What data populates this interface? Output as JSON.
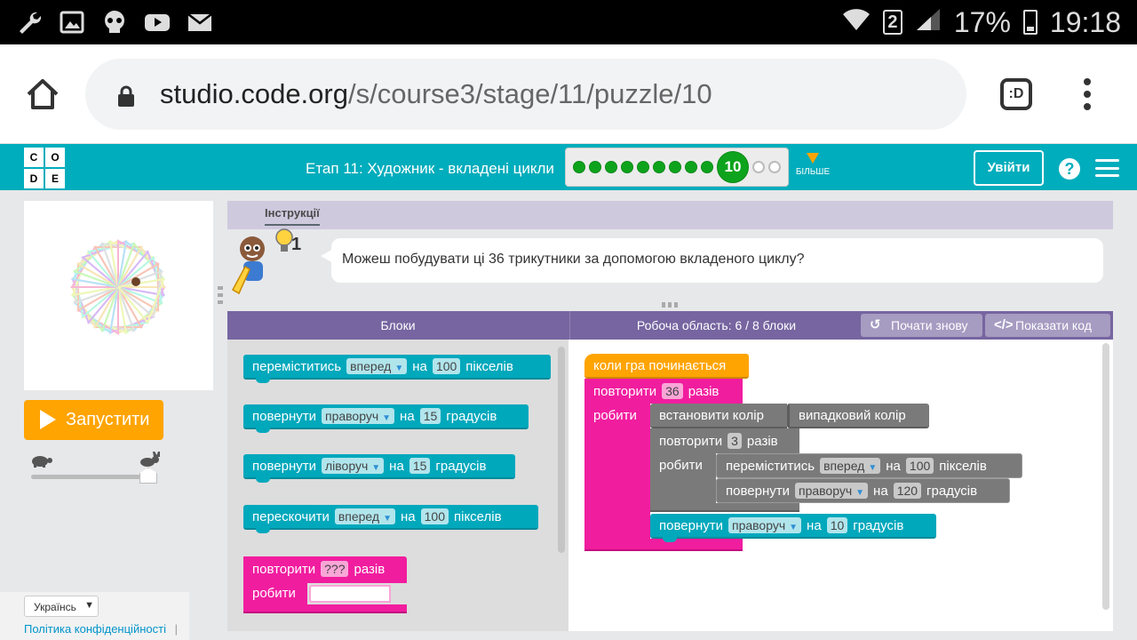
{
  "status_bar": {
    "icons": [
      "wrench-icon",
      "image-icon",
      "skull-icon",
      "youtube-icon",
      "mail-icon"
    ],
    "sim_slot": "2",
    "battery": "17%",
    "time": "19:18"
  },
  "browser": {
    "url_host": "studio.code.org",
    "url_path": "/s/course3/stage/11/puzzle/10",
    "tabs_label": ":D"
  },
  "header": {
    "logo_letters": [
      "C",
      "O",
      "D",
      "E"
    ],
    "stage_title": "Етап 11: Художник - вкладені цикли",
    "progress": {
      "completed": 9,
      "current": "10",
      "remaining": 2
    },
    "more_label": "БІЛЬШЕ",
    "signin_label": "Увійти",
    "help_label": "?",
    "accent_color": "#00adbc"
  },
  "left": {
    "run_label": "Запустити",
    "language": "Українсь",
    "privacy_link": "Політика конфіденційності",
    "privacy_sep": "|"
  },
  "instructions": {
    "tab_label": "Інструкції",
    "hint_count": "1",
    "text": "Можеш побудувати ці 36 трикутники за допомогою вкладеного циклу?"
  },
  "workspace_header": {
    "blocks_title": "Блоки",
    "workspace_title": "Робоча область: 6 / 8 блоки",
    "reset_label": "Почати знову",
    "show_code_label": "Показати код"
  },
  "toolbox": {
    "move": {
      "label": "переміститись",
      "dir": "вперед",
      "on": "на",
      "value": "100",
      "unit": "пікселів"
    },
    "turn_right": {
      "label": "повернути",
      "dir": "праворуч",
      "on": "на",
      "value": "15",
      "unit": "градусів"
    },
    "turn_left": {
      "label": "повернути",
      "dir": "ліворуч",
      "on": "на",
      "value": "15",
      "unit": "градусів"
    },
    "jump": {
      "label": "перескочити",
      "dir": "вперед",
      "on": "на",
      "value": "100",
      "unit": "пікселів"
    },
    "repeat": {
      "label": "повторити",
      "value": "???",
      "unit": "разів",
      "do": "робити"
    }
  },
  "program": {
    "when_run": "коли гра починається",
    "outer_repeat": {
      "label": "повторити",
      "value": "36",
      "unit": "разів",
      "do": "робити"
    },
    "set_color": {
      "label": "встановити колір",
      "value": "випадковий колір"
    },
    "inner_repeat": {
      "label": "повторити",
      "value": "3",
      "unit": "разів",
      "do": "робити"
    },
    "inner_move": {
      "label": "переміститись",
      "dir": "вперед",
      "on": "на",
      "value": "100",
      "unit": "пікселів"
    },
    "inner_turn": {
      "label": "повернути",
      "dir": "праворуч",
      "on": "на",
      "value": "120",
      "unit": "градусів"
    },
    "outer_turn": {
      "label": "повернути",
      "dir": "праворуч",
      "on": "на",
      "value": "10",
      "unit": "градусів"
    }
  }
}
